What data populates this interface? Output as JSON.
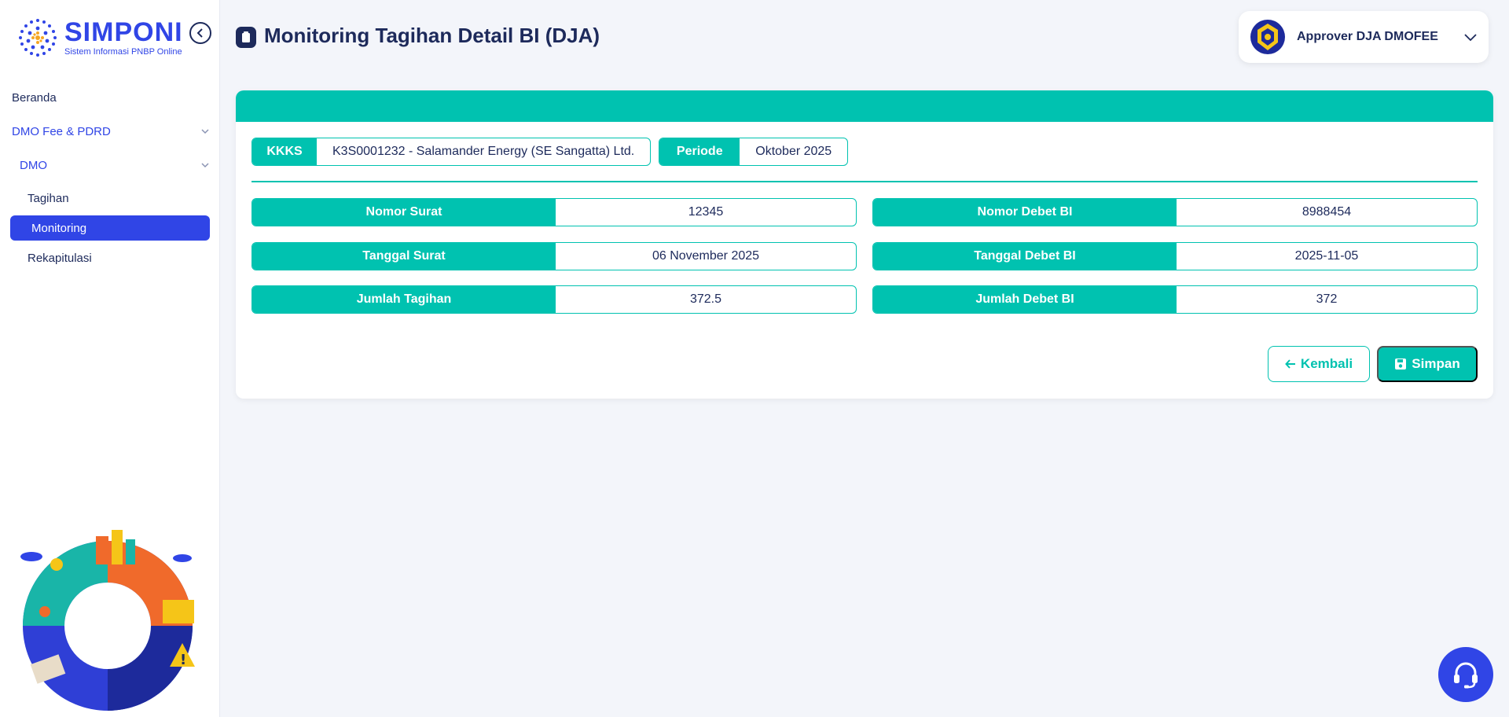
{
  "app": {
    "logo_title": "SIMPONI",
    "logo_subtitle": "Sistem Informasi PNBP Online"
  },
  "sidebar": {
    "items": [
      {
        "label": "Beranda"
      },
      {
        "label": "DMO Fee & PDRD"
      },
      {
        "label": "DMO"
      },
      {
        "label": "Tagihan"
      },
      {
        "label": "Monitoring",
        "active": true
      },
      {
        "label": "Rekapitulasi"
      }
    ]
  },
  "header": {
    "title": "Monitoring Tagihan Detail BI (DJA)",
    "user": "Approver DJA DMOFEE"
  },
  "filters": {
    "kkks_label": "KKKS",
    "kkks_value": "K3S0001232 - Salamander Energy (SE Sangatta) Ltd.",
    "periode_label": "Periode",
    "periode_value": "Oktober 2025"
  },
  "fields": {
    "nomor_surat_label": "Nomor Surat",
    "nomor_surat_value": "12345",
    "nomor_debet_label": "Nomor Debet BI",
    "nomor_debet_value": "8988454",
    "tanggal_surat_label": "Tanggal Surat",
    "tanggal_surat_value": "06 November 2025",
    "tanggal_debet_label": "Tanggal Debet BI",
    "tanggal_debet_value": "2025-11-05",
    "jumlah_tagihan_label": "Jumlah Tagihan",
    "jumlah_tagihan_value": "372.5",
    "jumlah_debet_label": "Jumlah Debet BI",
    "jumlah_debet_value": "372"
  },
  "actions": {
    "back_label": "Kembali",
    "save_label": "Simpan"
  },
  "colors": {
    "accent": "#00c2b0",
    "primary": "#3045e6",
    "text": "#1d2a5b"
  }
}
